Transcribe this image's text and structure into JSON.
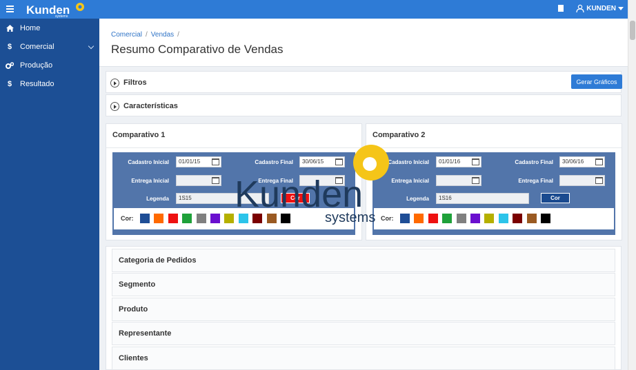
{
  "topbar": {
    "logo_text": "Kunden",
    "logo_sub": "systems",
    "user_label": "KUNDEN",
    "accent": "#2e7bd6"
  },
  "sidebar": {
    "bg": "#1c4f95",
    "items": [
      {
        "icon": "home-icon",
        "label": "Home"
      },
      {
        "icon": "dollar-icon",
        "label": "Comercial"
      },
      {
        "icon": "gears-icon",
        "label": "Produção"
      },
      {
        "icon": "dollar-icon",
        "label": "Resultado"
      }
    ]
  },
  "breadcrumb": [
    "Comercial",
    "Vendas"
  ],
  "page_title": "Resumo Comparativo de Vendas",
  "filters": {
    "label": "Filtros",
    "button": "Gerar Gráficos"
  },
  "caracteristicas": {
    "label": "Características"
  },
  "comparativo1": {
    "title": "Comparativo 1",
    "cadastro_inicial_label": "Cadastro Inicial",
    "cadastro_inicial": "01/01/15",
    "cadastro_final_label": "Cadastro Final",
    "cadastro_final": "30/06/15",
    "entrega_inicial_label": "Entrega Inicial",
    "entrega_inicial": "",
    "entrega_final_label": "Entrega Final",
    "entrega_final": "",
    "legenda_label": "Legenda",
    "legenda": "1S15",
    "cor_button": "Cor",
    "cor_button_color": "#ee1111",
    "cor_label": "Cor:"
  },
  "comparativo2": {
    "title": "Comparativo 2",
    "cadastro_inicial_label": "Cadastro Inicial",
    "cadastro_inicial": "01/01/16",
    "cadastro_final_label": "Cadastro Final",
    "cadastro_final": "30/06/16",
    "entrega_inicial_label": "Entrega Inicial",
    "entrega_inicial": "",
    "entrega_final_label": "Entrega Final",
    "entrega_final": "",
    "legenda_label": "Legenda",
    "legenda": "1S16",
    "cor_button": "Cor",
    "cor_button_color": "#1a4a8f",
    "cor_label": "Cor:"
  },
  "swatches": [
    "#1f4e96",
    "#ff6a00",
    "#ee1111",
    "#1fa13a",
    "#808080",
    "#6a0fcf",
    "#b5b000",
    "#2cc4ea",
    "#7a0000",
    "#9a5a22",
    "#000000"
  ],
  "categories": [
    "Categoria de Pedidos",
    "Segmento",
    "Produto",
    "Representante",
    "Clientes"
  ],
  "watermark": {
    "text": "Kunden",
    "sub": "systems"
  }
}
